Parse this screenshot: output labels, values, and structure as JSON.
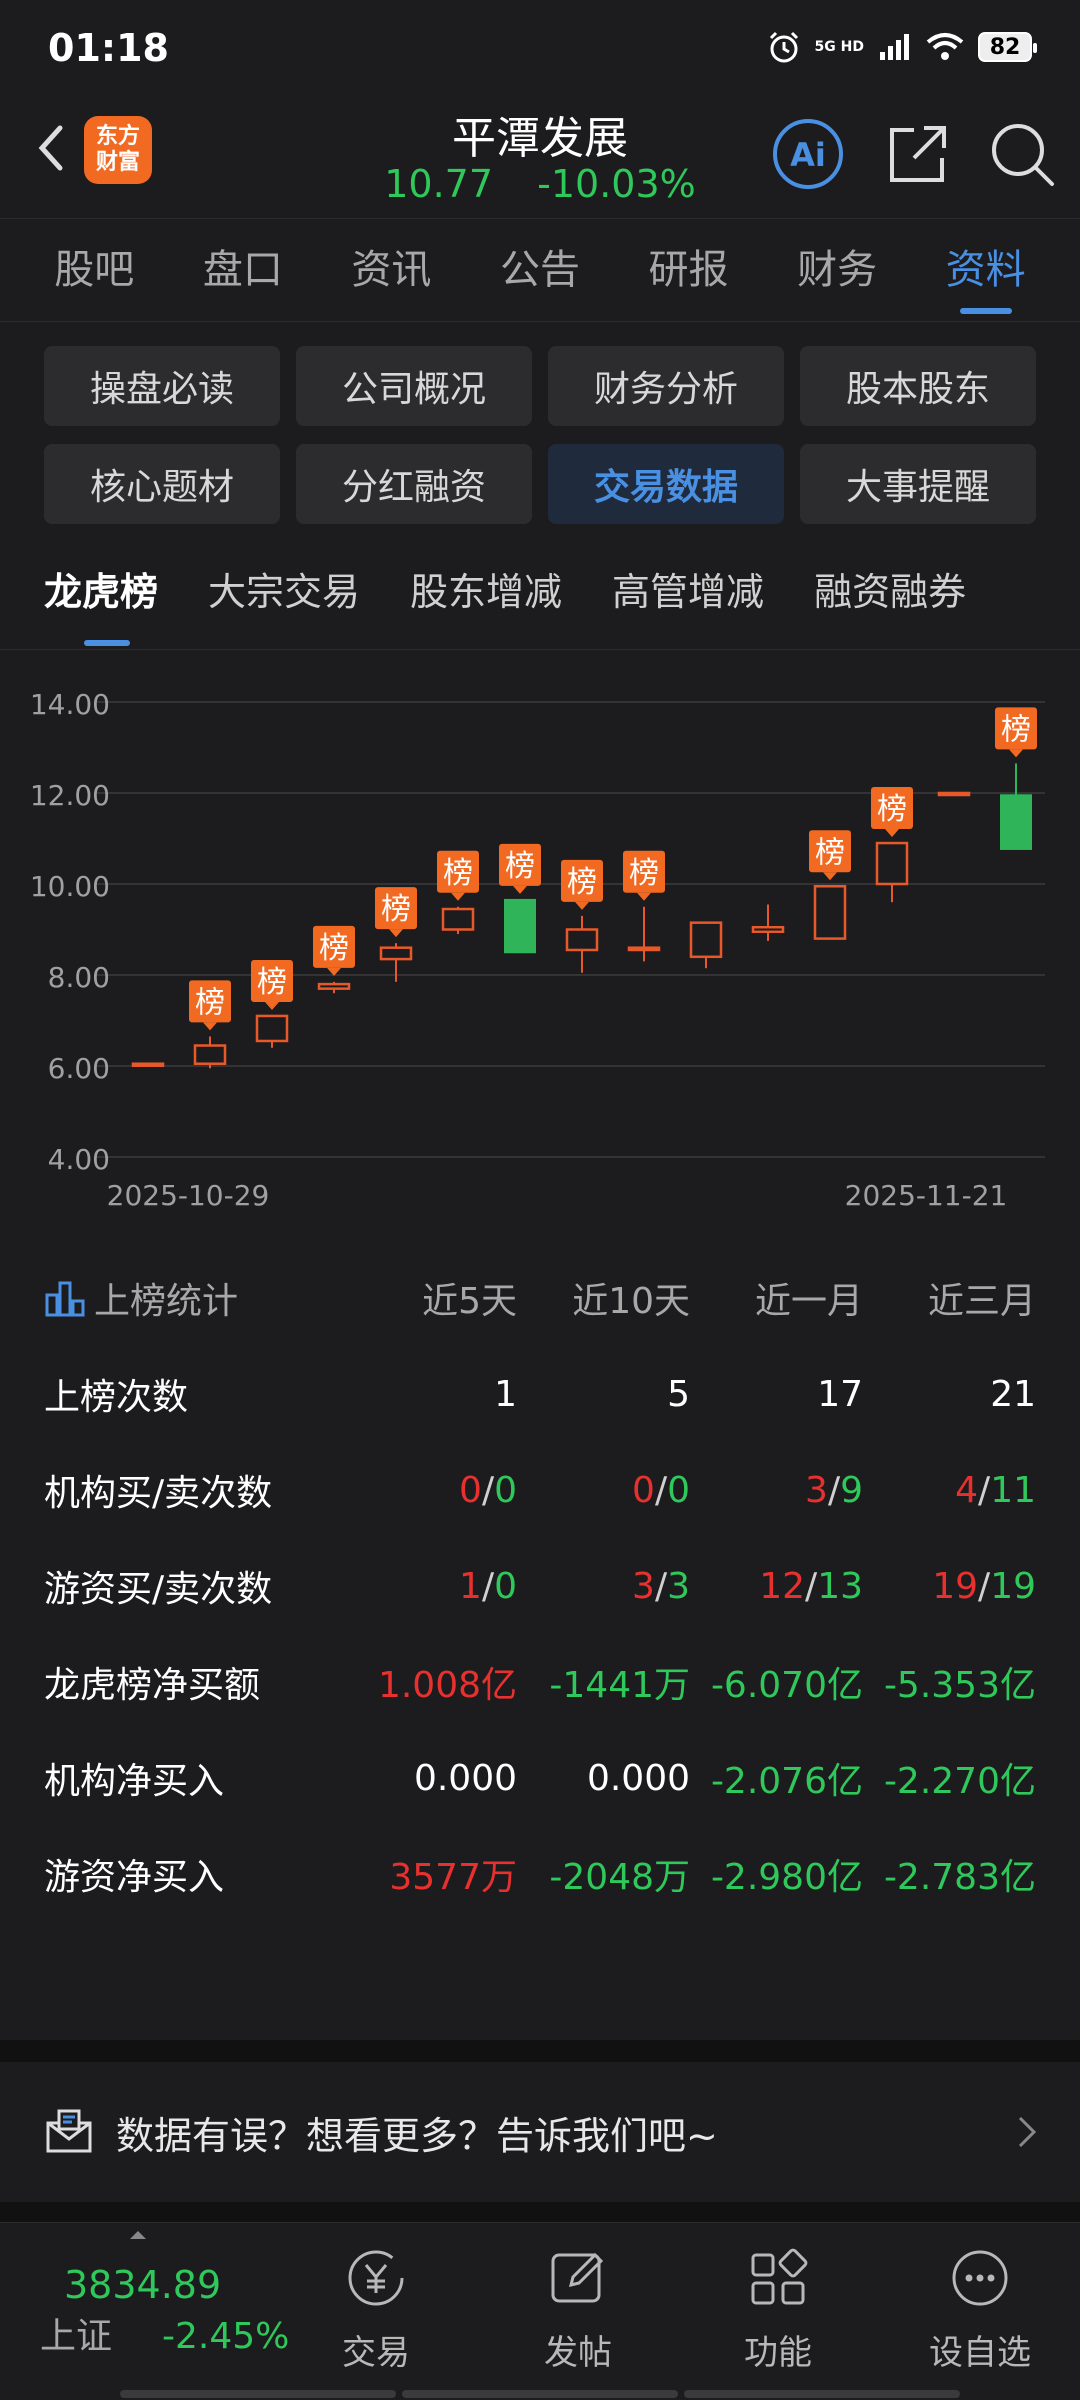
{
  "status": {
    "time": "01:18",
    "net": "5G HD",
    "battery": "82"
  },
  "header": {
    "logo_line1": "东方",
    "logo_line2": "财富",
    "title": "平潭发展",
    "price": "10.77",
    "change": "-10.03%"
  },
  "main_tabs": [
    "股吧",
    "盘口",
    "资讯",
    "公告",
    "研报",
    "财务",
    "资料"
  ],
  "sub_buttons": [
    "操盘必读",
    "公司概况",
    "财务分析",
    "股本股东",
    "核心题材",
    "分红融资",
    "交易数据",
    "大事提醒"
  ],
  "third_tabs": [
    "龙虎榜",
    "大宗交易",
    "股东增减",
    "高管增减",
    "融资融券"
  ],
  "chart_data": {
    "type": "candlestick",
    "y_ticks": [
      "14.00",
      "12.00",
      "10.00",
      "8.00",
      "6.00",
      "4.00"
    ],
    "ylim": [
      4,
      14
    ],
    "x_labels": [
      "2025-10-29",
      "2025-11-21"
    ],
    "marker_label": "榜",
    "candles": [
      {
        "o": 6.05,
        "c": 6.05,
        "h": 6.05,
        "l": 6.05,
        "up": true,
        "tag": false
      },
      {
        "o": 6.05,
        "c": 6.45,
        "h": 6.65,
        "l": 5.95,
        "up": true,
        "tag": true
      },
      {
        "o": 6.55,
        "c": 7.1,
        "h": 7.1,
        "l": 6.4,
        "up": true,
        "tag": true
      },
      {
        "o": 7.7,
        "c": 7.8,
        "h": 7.85,
        "l": 7.6,
        "up": true,
        "tag": true
      },
      {
        "o": 8.35,
        "c": 8.6,
        "h": 8.7,
        "l": 7.85,
        "up": true,
        "tag": true
      },
      {
        "o": 9.0,
        "c": 9.45,
        "h": 9.5,
        "l": 8.9,
        "up": true,
        "tag": true
      },
      {
        "o": 9.65,
        "c": 8.5,
        "h": 9.65,
        "l": 8.5,
        "up": false,
        "tag": true
      },
      {
        "o": 8.55,
        "c": 9.0,
        "h": 9.3,
        "l": 8.05,
        "up": true,
        "tag": true
      },
      {
        "o": 8.55,
        "c": 8.6,
        "h": 9.5,
        "l": 8.3,
        "up": true,
        "tag": true
      },
      {
        "o": 8.4,
        "c": 9.15,
        "h": 9.15,
        "l": 8.15,
        "up": true,
        "tag": false
      },
      {
        "o": 8.95,
        "c": 9.05,
        "h": 9.55,
        "l": 8.75,
        "up": true,
        "tag": false
      },
      {
        "o": 8.8,
        "c": 9.95,
        "h": 9.95,
        "l": 8.8,
        "up": true,
        "tag": true
      },
      {
        "o": 10.0,
        "c": 10.9,
        "h": 10.9,
        "l": 9.6,
        "up": true,
        "tag": true
      },
      {
        "o": 12.0,
        "c": 12.0,
        "h": 12.0,
        "l": 12.0,
        "up": true,
        "tag": false
      },
      {
        "o": 11.95,
        "c": 10.77,
        "h": 12.65,
        "l": 10.77,
        "up": false,
        "tag": true
      }
    ]
  },
  "stats": {
    "title": "上榜统计",
    "periods": [
      "近5天",
      "近10天",
      "近一月",
      "近三月"
    ],
    "rows": [
      {
        "label": "上榜次数",
        "cells": [
          {
            "t": "1",
            "c": "white"
          },
          {
            "t": "5",
            "c": "white"
          },
          {
            "t": "17",
            "c": "white"
          },
          {
            "t": "21",
            "c": "white"
          }
        ]
      },
      {
        "label": "机构买/卖次数",
        "cells": [
          {
            "a": "0",
            "b": "0"
          },
          {
            "a": "0",
            "b": "0"
          },
          {
            "a": "3",
            "b": "9"
          },
          {
            "a": "4",
            "b": "11"
          }
        ]
      },
      {
        "label": "游资买/卖次数",
        "cells": [
          {
            "a": "1",
            "b": "0"
          },
          {
            "a": "3",
            "b": "3"
          },
          {
            "a": "12",
            "b": "13"
          },
          {
            "a": "19",
            "b": "19"
          }
        ]
      },
      {
        "label": "龙虎榜净买额",
        "cells": [
          {
            "t": "1.008亿",
            "c": "red"
          },
          {
            "t": "-1441万",
            "c": "green"
          },
          {
            "t": "-6.070亿",
            "c": "green"
          },
          {
            "t": "-5.353亿",
            "c": "green"
          }
        ]
      },
      {
        "label": "机构净买入",
        "cells": [
          {
            "t": "0.000",
            "c": "white"
          },
          {
            "t": "0.000",
            "c": "white"
          },
          {
            "t": "-2.076亿",
            "c": "green"
          },
          {
            "t": "-2.270亿",
            "c": "green"
          }
        ]
      },
      {
        "label": "游资净买入",
        "cells": [
          {
            "t": "3577万",
            "c": "red"
          },
          {
            "t": "-2048万",
            "c": "green"
          },
          {
            "t": "-2.980亿",
            "c": "green"
          },
          {
            "t": "-2.783亿",
            "c": "green"
          }
        ]
      }
    ]
  },
  "feedback": {
    "text": "数据有误？想看更多？告诉我们吧~"
  },
  "bottom": {
    "index_value": "3834.89",
    "index_name": "上证",
    "index_pct": "-2.45%",
    "nav": [
      "交易",
      "发帖",
      "功能",
      "设自选"
    ]
  },
  "colors": {
    "accent": "#4a90e2",
    "up": "#e8592a",
    "down": "#2fb45a",
    "tag": "#f26a22"
  }
}
